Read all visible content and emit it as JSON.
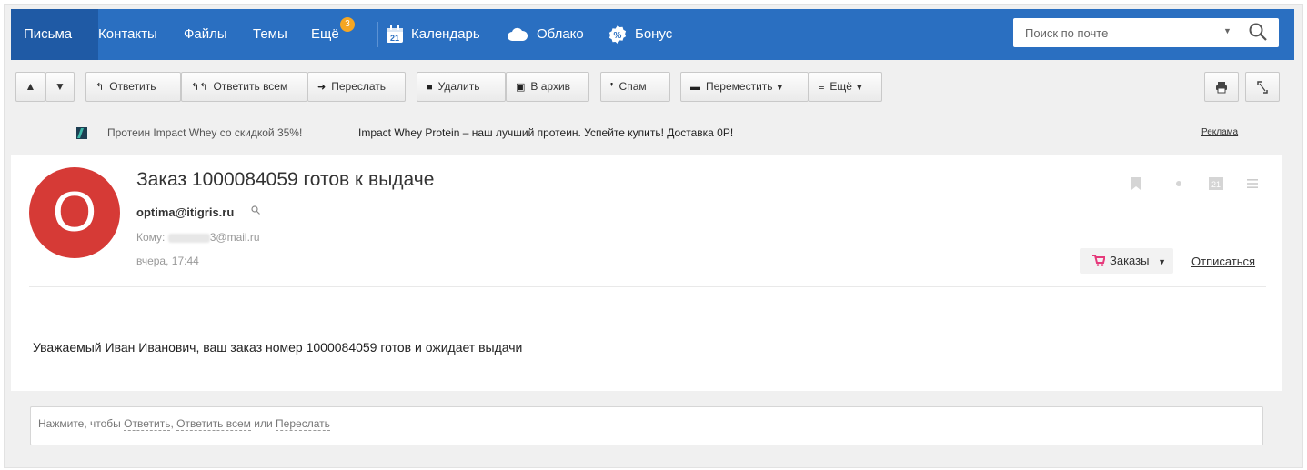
{
  "nav": {
    "items": [
      {
        "label": "Письма",
        "active": true
      },
      {
        "label": "Контакты"
      },
      {
        "label": "Файлы"
      },
      {
        "label": "Темы"
      },
      {
        "label": "Ещё",
        "badge": "3"
      }
    ],
    "apps": [
      {
        "label": "Календарь",
        "icon": "calendar-icon",
        "icon_text": "21"
      },
      {
        "label": "Облако",
        "icon": "cloud-icon"
      },
      {
        "label": "Бонус",
        "icon": "bonus-icon"
      }
    ],
    "search": {
      "placeholder": "Поиск по почте"
    }
  },
  "toolbar": {
    "reply": "Ответить",
    "reply_all": "Ответить всем",
    "forward": "Переслать",
    "delete": "Удалить",
    "archive": "В архив",
    "spam": "Спам",
    "move": "Переместить",
    "more": "Ещё"
  },
  "ad": {
    "title": "Протеин Impact Whey со скидкой 35%!",
    "text": "Impact Whey Protein – наш лучший протеин. Успейте купить! Доставка 0Р!",
    "label": "Реклама"
  },
  "message": {
    "avatar_letter": "O",
    "subject": "Заказ 1000084059 готов к выдаче",
    "from": "optima@itigris.ru",
    "to_label": "Кому:",
    "to_domain": "3@mail.ru",
    "date": "вчера, 17:44",
    "orders_label": "Заказы",
    "unsubscribe": "Отписаться",
    "body": "Уважаемый Иван Иванович, ваш заказ номер 1000084059 готов и ожидает выдачи",
    "calendar_day": "21"
  },
  "reply": {
    "prefix": "Нажмите, чтобы",
    "reply": "Ответить",
    "sep": ",",
    "reply_all": "Ответить всем",
    "or": "или",
    "forward": "Переслать"
  },
  "colors": {
    "nav_bg": "#2a6fc1",
    "avatar_bg": "#d63a36",
    "badge": "#f5a623",
    "cart": "#e6397b"
  }
}
